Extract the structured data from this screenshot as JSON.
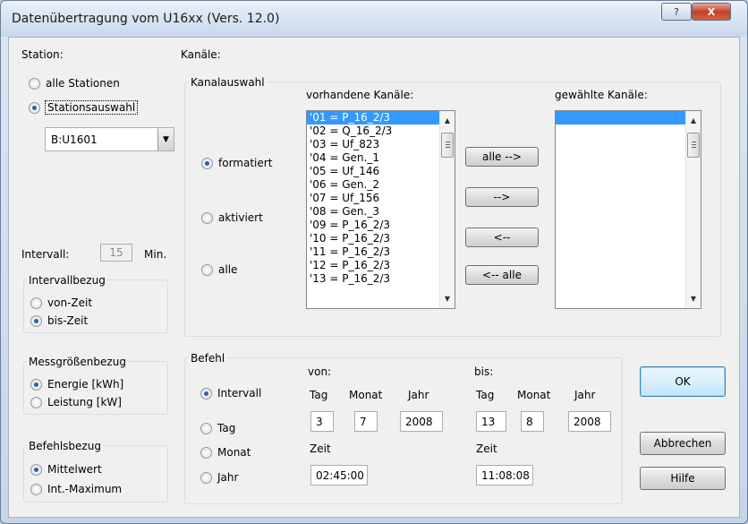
{
  "window": {
    "title": "Datenübertragung vom U16xx (Vers. 12.0)",
    "help_glyph": "?",
    "close_glyph": "X"
  },
  "station": {
    "label": "Station:",
    "all_label": "alle Stationen",
    "select_label": "Stationsauswahl",
    "selected": "select",
    "combo_value": "B:U1601"
  },
  "interval": {
    "label": "Intervall:",
    "value": "15",
    "unit": "Min."
  },
  "intervallbezug": {
    "legend": "Intervallbezug",
    "options": [
      "von-Zeit",
      "bis-Zeit"
    ],
    "selected_index": 1
  },
  "messgroessenbezug": {
    "legend": "Messgrößenbezug",
    "options": [
      "Energie [kWh]",
      "Leistung [kW]"
    ],
    "selected_index": 0
  },
  "befehlsbezug": {
    "legend": "Befehlsbezug",
    "options": [
      "Mittelwert",
      "Int.-Maximum"
    ],
    "selected_index": 0
  },
  "kanaele": {
    "label": "Kanäle:",
    "group_legend": "Kanalauswahl",
    "format_options": [
      "formatiert",
      "aktiviert",
      "alle"
    ],
    "format_selected_index": 0,
    "available_header": "vorhandene Kanäle:",
    "selected_header": "gewählte Kanäle:",
    "available": [
      "'01 = P_16_2/3",
      "'02 = Q_16_2/3",
      "'03 = Uf_823",
      "'04 = Gen._1",
      "'05 = Uf_146",
      "'06 = Gen._2",
      "'07 = Uf_156",
      "'08 = Gen._3",
      "'09 = P_16_2/3",
      "'10 = P_16_2/3",
      "'11 = P_16_2/3",
      "'12 = P_16_2/3",
      "'13 = P_16_2/3"
    ],
    "available_selected_index": 0,
    "selected_items": [
      ""
    ],
    "buttons": {
      "all_right": "alle -->",
      "right": "-->",
      "left": "<--",
      "all_left": "<-- alle"
    }
  },
  "befehl": {
    "legend": "Befehl",
    "options": [
      "Intervall",
      "Tag",
      "Monat",
      "Jahr"
    ],
    "selected_index": 0,
    "von": {
      "label": "von:",
      "tag_label": "Tag",
      "monat_label": "Monat",
      "jahr_label": "Jahr",
      "tag": "3",
      "monat": "7",
      "jahr": "2008",
      "zeit_label": "Zeit",
      "zeit": "02:45:00"
    },
    "bis": {
      "label": "bis:",
      "tag_label": "Tag",
      "monat_label": "Monat",
      "jahr_label": "Jahr",
      "tag": "13",
      "monat": "8",
      "jahr": "2008",
      "zeit_label": "Zeit",
      "zeit": "11:08:08"
    }
  },
  "buttons": {
    "ok": "OK",
    "cancel": "Abbrechen",
    "help": "Hilfe"
  }
}
